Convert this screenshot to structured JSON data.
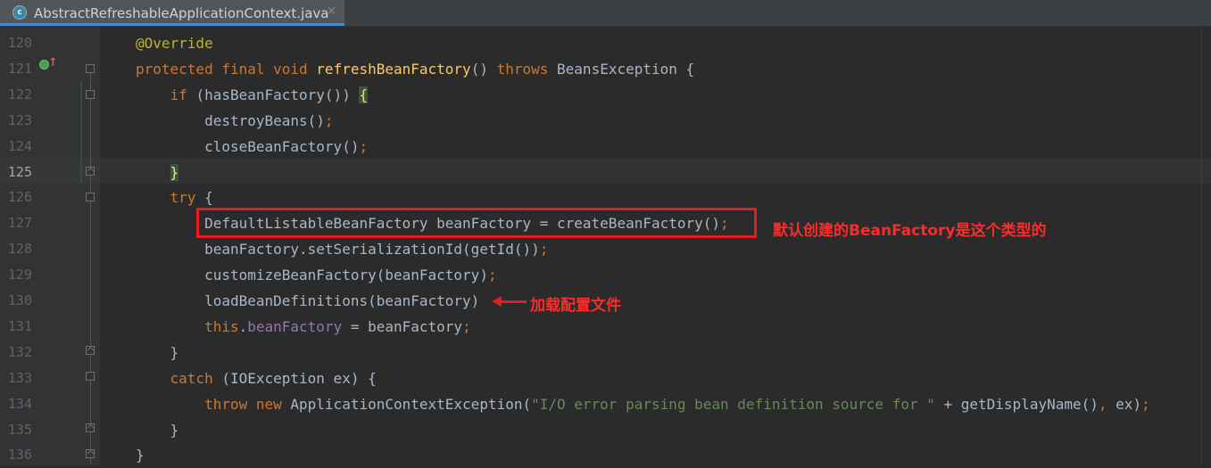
{
  "tab": {
    "icon_label": "c",
    "title": "AbstractRefreshableApplicationContext.java",
    "close": "×"
  },
  "lines": [
    {
      "num": "120",
      "html": "<span class=\"an\">@Override</span>"
    },
    {
      "num": "121",
      "html": "<span class=\"k\">protected final void </span><span class=\"fn\">refreshBeanFactory</span>() <span class=\"k\">throws </span>BeansException {"
    },
    {
      "num": "122",
      "html": "    <span class=\"k\">if </span>(hasBeanFactory()) <span class=\"brk\">{</span>"
    },
    {
      "num": "123",
      "html": "        destroyBeans()<span class=\"k\">;</span>"
    },
    {
      "num": "124",
      "html": "        closeBeanFactory()<span class=\"k\">;</span>"
    },
    {
      "num": "125",
      "html": "    <span class=\"brk\">}</span>"
    },
    {
      "num": "126",
      "html": "    <span class=\"k\">try </span>{"
    },
    {
      "num": "127",
      "html": "        DefaultListableBeanFactory beanFactory = createBeanFactory()<span class=\"k\">;</span>"
    },
    {
      "num": "128",
      "html": "        beanFactory.setSerializationId(getId())<span class=\"k\">;</span>"
    },
    {
      "num": "129",
      "html": "        customizeBeanFactory(beanFactory)<span class=\"k\">;</span>"
    },
    {
      "num": "130",
      "html": "        loadBeanDefinitions(beanFactory)"
    },
    {
      "num": "131",
      "html": "        <span class=\"k\">this</span>.<span class=\"fld\">beanFactory </span>= beanFactory<span class=\"k\">;</span>"
    },
    {
      "num": "132",
      "html": "    }"
    },
    {
      "num": "133",
      "html": "    <span class=\"k\">catch </span>(IOException ex) {"
    },
    {
      "num": "134",
      "html": "        <span class=\"k\">throw new </span>ApplicationContextException(<span class=\"str\">\"I/O error parsing bean definition source for \" </span>+ getDisplayName()<span class=\"k\">, </span>ex)<span class=\"k\">;</span>"
    },
    {
      "num": "135",
      "html": "    }"
    },
    {
      "num": "136",
      "html": "}"
    }
  ],
  "annotations": {
    "box_note": "默认创建的BeanFactory是这个类型的",
    "arrow_note": "加载配置文件"
  },
  "colors": {
    "keyword": "#cc7832",
    "annotation": "#bbb529",
    "method": "#ffc66d",
    "string": "#6a8759",
    "highlight_red": "#e51c23"
  }
}
